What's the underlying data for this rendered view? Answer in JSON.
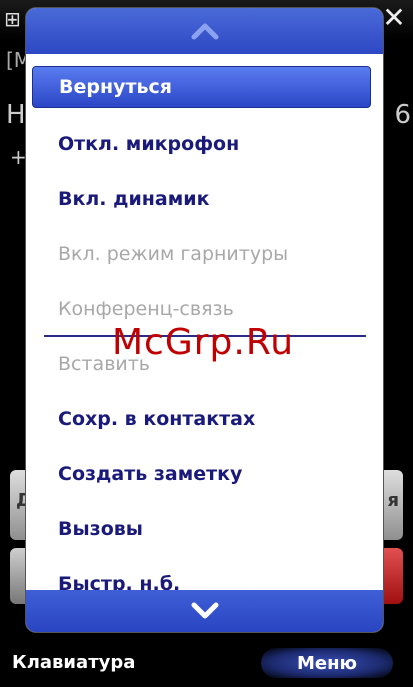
{
  "background": {
    "caller_partial": "[M",
    "number_left_partial": "H",
    "number_right_partial": "6",
    "plus_symbol": "+",
    "left_button_partial": "Д",
    "right_button_partial": "я"
  },
  "menu": {
    "scroll_up_icon": "chevron-up-icon",
    "scroll_down_icon": "chevron-down-icon",
    "items": [
      {
        "label": "Вернуться",
        "state": "selected"
      },
      {
        "label": "Откл. микрофон",
        "state": "enabled"
      },
      {
        "label": "Вкл. динамик",
        "state": "enabled"
      },
      {
        "label": "Вкл. режим гарнитуры",
        "state": "disabled"
      },
      {
        "label": "Конференц-связь",
        "state": "disabled"
      },
      {
        "label": "Вставить",
        "state": "disabled"
      },
      {
        "label": "Сохр. в контактах",
        "state": "enabled"
      },
      {
        "label": "Создать заметку",
        "state": "enabled"
      },
      {
        "label": "Вызовы",
        "state": "enabled"
      },
      {
        "label": "Быстр. н.б.",
        "state": "partial"
      }
    ]
  },
  "watermark": "McGrp.Ru",
  "softkeys": {
    "left_label": "Клавиатура",
    "right_label": "Меню"
  },
  "colors": {
    "accent": "#2d48c4",
    "menu_text": "#1a1a7a",
    "disabled_text": "#a8a8a8",
    "watermark": "#c00000"
  }
}
